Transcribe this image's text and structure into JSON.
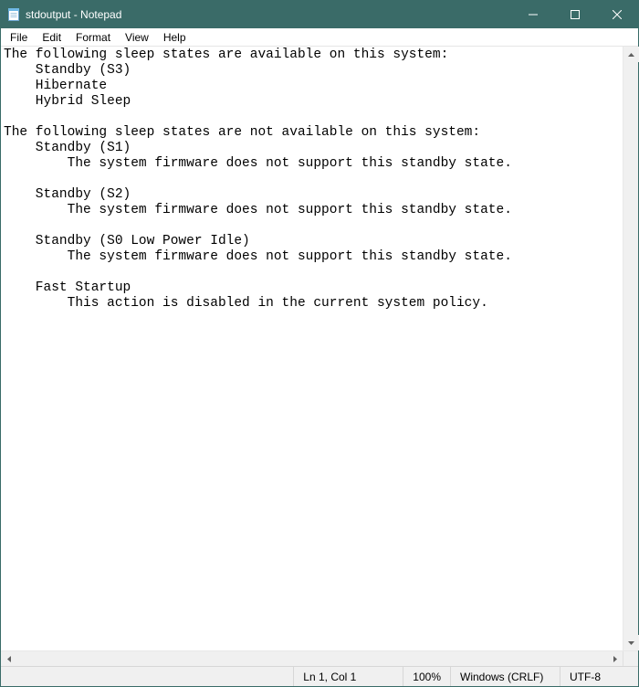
{
  "window": {
    "title": "stdoutput - Notepad"
  },
  "menu": {
    "file": "File",
    "edit": "Edit",
    "format": "Format",
    "view": "View",
    "help": "Help"
  },
  "editor": {
    "content": "The following sleep states are available on this system:\n    Standby (S3)\n    Hibernate\n    Hybrid Sleep\n\nThe following sleep states are not available on this system:\n    Standby (S1)\n        The system firmware does not support this standby state.\n\n    Standby (S2)\n        The system firmware does not support this standby state.\n\n    Standby (S0 Low Power Idle)\n        The system firmware does not support this standby state.\n\n    Fast Startup\n        This action is disabled in the current system policy."
  },
  "status": {
    "position": "Ln 1, Col 1",
    "zoom": "100%",
    "eol": "Windows (CRLF)",
    "encoding": "UTF-8"
  }
}
